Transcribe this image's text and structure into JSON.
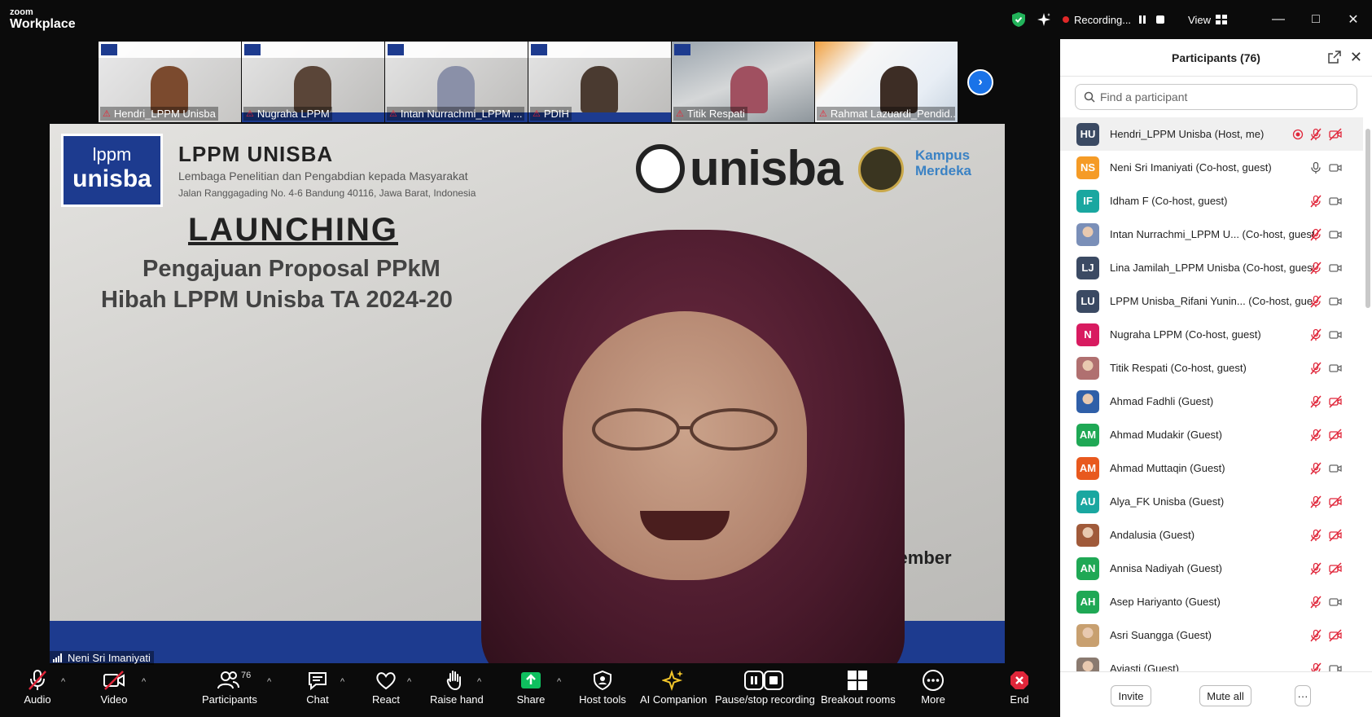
{
  "app": {
    "brand_top": "zoom",
    "brand_bottom": "Workplace"
  },
  "titlebar": {
    "recording_label": "Recording...",
    "view_label": "View"
  },
  "colors": {
    "accent": "#1a73e8",
    "recording": "#e02828",
    "mute_red": "#e0263a",
    "green_share": "#0fbf5f",
    "unisba_blue": "#1d3b8f"
  },
  "filmstrip": [
    {
      "name": "Hendri_LPPM Unisba"
    },
    {
      "name": "Nugraha LPPM"
    },
    {
      "name": "Intan Nurrachmi_LPPM ..."
    },
    {
      "name": "PDIH"
    },
    {
      "name": "Titik Respati"
    },
    {
      "name": "Rahmat Lazuardi_Pendid..."
    }
  ],
  "slide": {
    "logo_top": "lppm",
    "logo_bottom": "unisba",
    "org_title": "LPPM UNISBA",
    "org_subtitle": "Lembaga Penelitian dan Pengabdian kepada Masyarakat",
    "org_address": "Jalan Ranggagading No. 4-6 Bandung 40116, Jawa Barat, Indonesia",
    "brand_word": "unisba",
    "kampus": "Kampus Merdeka",
    "heading": "LAUNCHING",
    "line1": "Pengajuan Proposal PPkM",
    "line2": "Hibah LPPM Unisba TA 2024-20",
    "date_fragment": "November"
  },
  "speaker": {
    "name": "Neni Sri Imaniyati"
  },
  "toolbar": {
    "audio": "Audio",
    "video": "Video",
    "participants": "Participants",
    "participants_count": "76",
    "chat": "Chat",
    "react": "React",
    "raise_hand": "Raise hand",
    "share": "Share",
    "host_tools": "Host tools",
    "ai_companion": "AI Companion",
    "pause_stop": "Pause/stop recording",
    "breakout": "Breakout rooms",
    "more": "More",
    "end": "End"
  },
  "panel": {
    "title": "Participants (76)",
    "search_placeholder": "Find a participant",
    "invite": "Invite",
    "mute_all": "Mute all",
    "more": "···"
  },
  "participants": [
    {
      "initials": "HU",
      "name": "Hendri_LPPM Unisba (Host, me)",
      "color": "#3b4a63",
      "mic": "muted",
      "video": "off",
      "recording": true
    },
    {
      "initials": "NS",
      "name": "Neni Sri Imaniyati (Co-host, guest)",
      "color": "#f59b26",
      "mic": "on",
      "video": "on"
    },
    {
      "initials": "IF",
      "name": "Idham F (Co-host, guest)",
      "color": "#1aa7a0",
      "mic": "muted",
      "video": "on"
    },
    {
      "initials": "",
      "name": "Intan Nurrachmi_LPPM U...  (Co-host, guest)",
      "color": "#7a8fb8",
      "mic": "muted",
      "video": "on",
      "photo": true
    },
    {
      "initials": "LJ",
      "name": "Lina Jamilah_LPPM Unisba (Co-host, guest)",
      "color": "#3b4a63",
      "mic": "muted",
      "video": "on"
    },
    {
      "initials": "LU",
      "name": "LPPM Unisba_Rifani Yunin...  (Co-host, guest)",
      "color": "#3b4a63",
      "mic": "muted",
      "video": "on"
    },
    {
      "initials": "N",
      "name": "Nugraha LPPM (Co-host, guest)",
      "color": "#d81b60",
      "mic": "muted",
      "video": "on"
    },
    {
      "initials": "",
      "name": "Titik Respati (Co-host, guest)",
      "color": "#b07070",
      "mic": "muted",
      "video": "on",
      "photo": true
    },
    {
      "initials": "",
      "name": "Ahmad Fadhli (Guest)",
      "color": "#2f5fa8",
      "mic": "muted",
      "video": "off",
      "photo": true
    },
    {
      "initials": "AM",
      "name": "Ahmad Mudakir (Guest)",
      "color": "#1fa855",
      "mic": "muted",
      "video": "off"
    },
    {
      "initials": "AM",
      "name": "Ahmad Muttaqin (Guest)",
      "color": "#e8591e",
      "mic": "muted",
      "video": "on"
    },
    {
      "initials": "AU",
      "name": "Alya_FK Unisba (Guest)",
      "color": "#1aa7a0",
      "mic": "muted",
      "video": "off"
    },
    {
      "initials": "",
      "name": "Andalusia (Guest)",
      "color": "#a05a3a",
      "mic": "muted",
      "video": "off",
      "photo": true
    },
    {
      "initials": "AN",
      "name": "Annisa Nadiyah (Guest)",
      "color": "#1fa855",
      "mic": "muted",
      "video": "off"
    },
    {
      "initials": "AH",
      "name": "Asep Hariyanto (Guest)",
      "color": "#1fa855",
      "mic": "muted",
      "video": "on"
    },
    {
      "initials": "",
      "name": "Asri Suangga (Guest)",
      "color": "#c8a070",
      "mic": "muted",
      "video": "off",
      "photo": true
    },
    {
      "initials": "",
      "name": "Aviasti (Guest)",
      "color": "#8a7a70",
      "mic": "muted",
      "video": "on",
      "photo": true
    }
  ]
}
